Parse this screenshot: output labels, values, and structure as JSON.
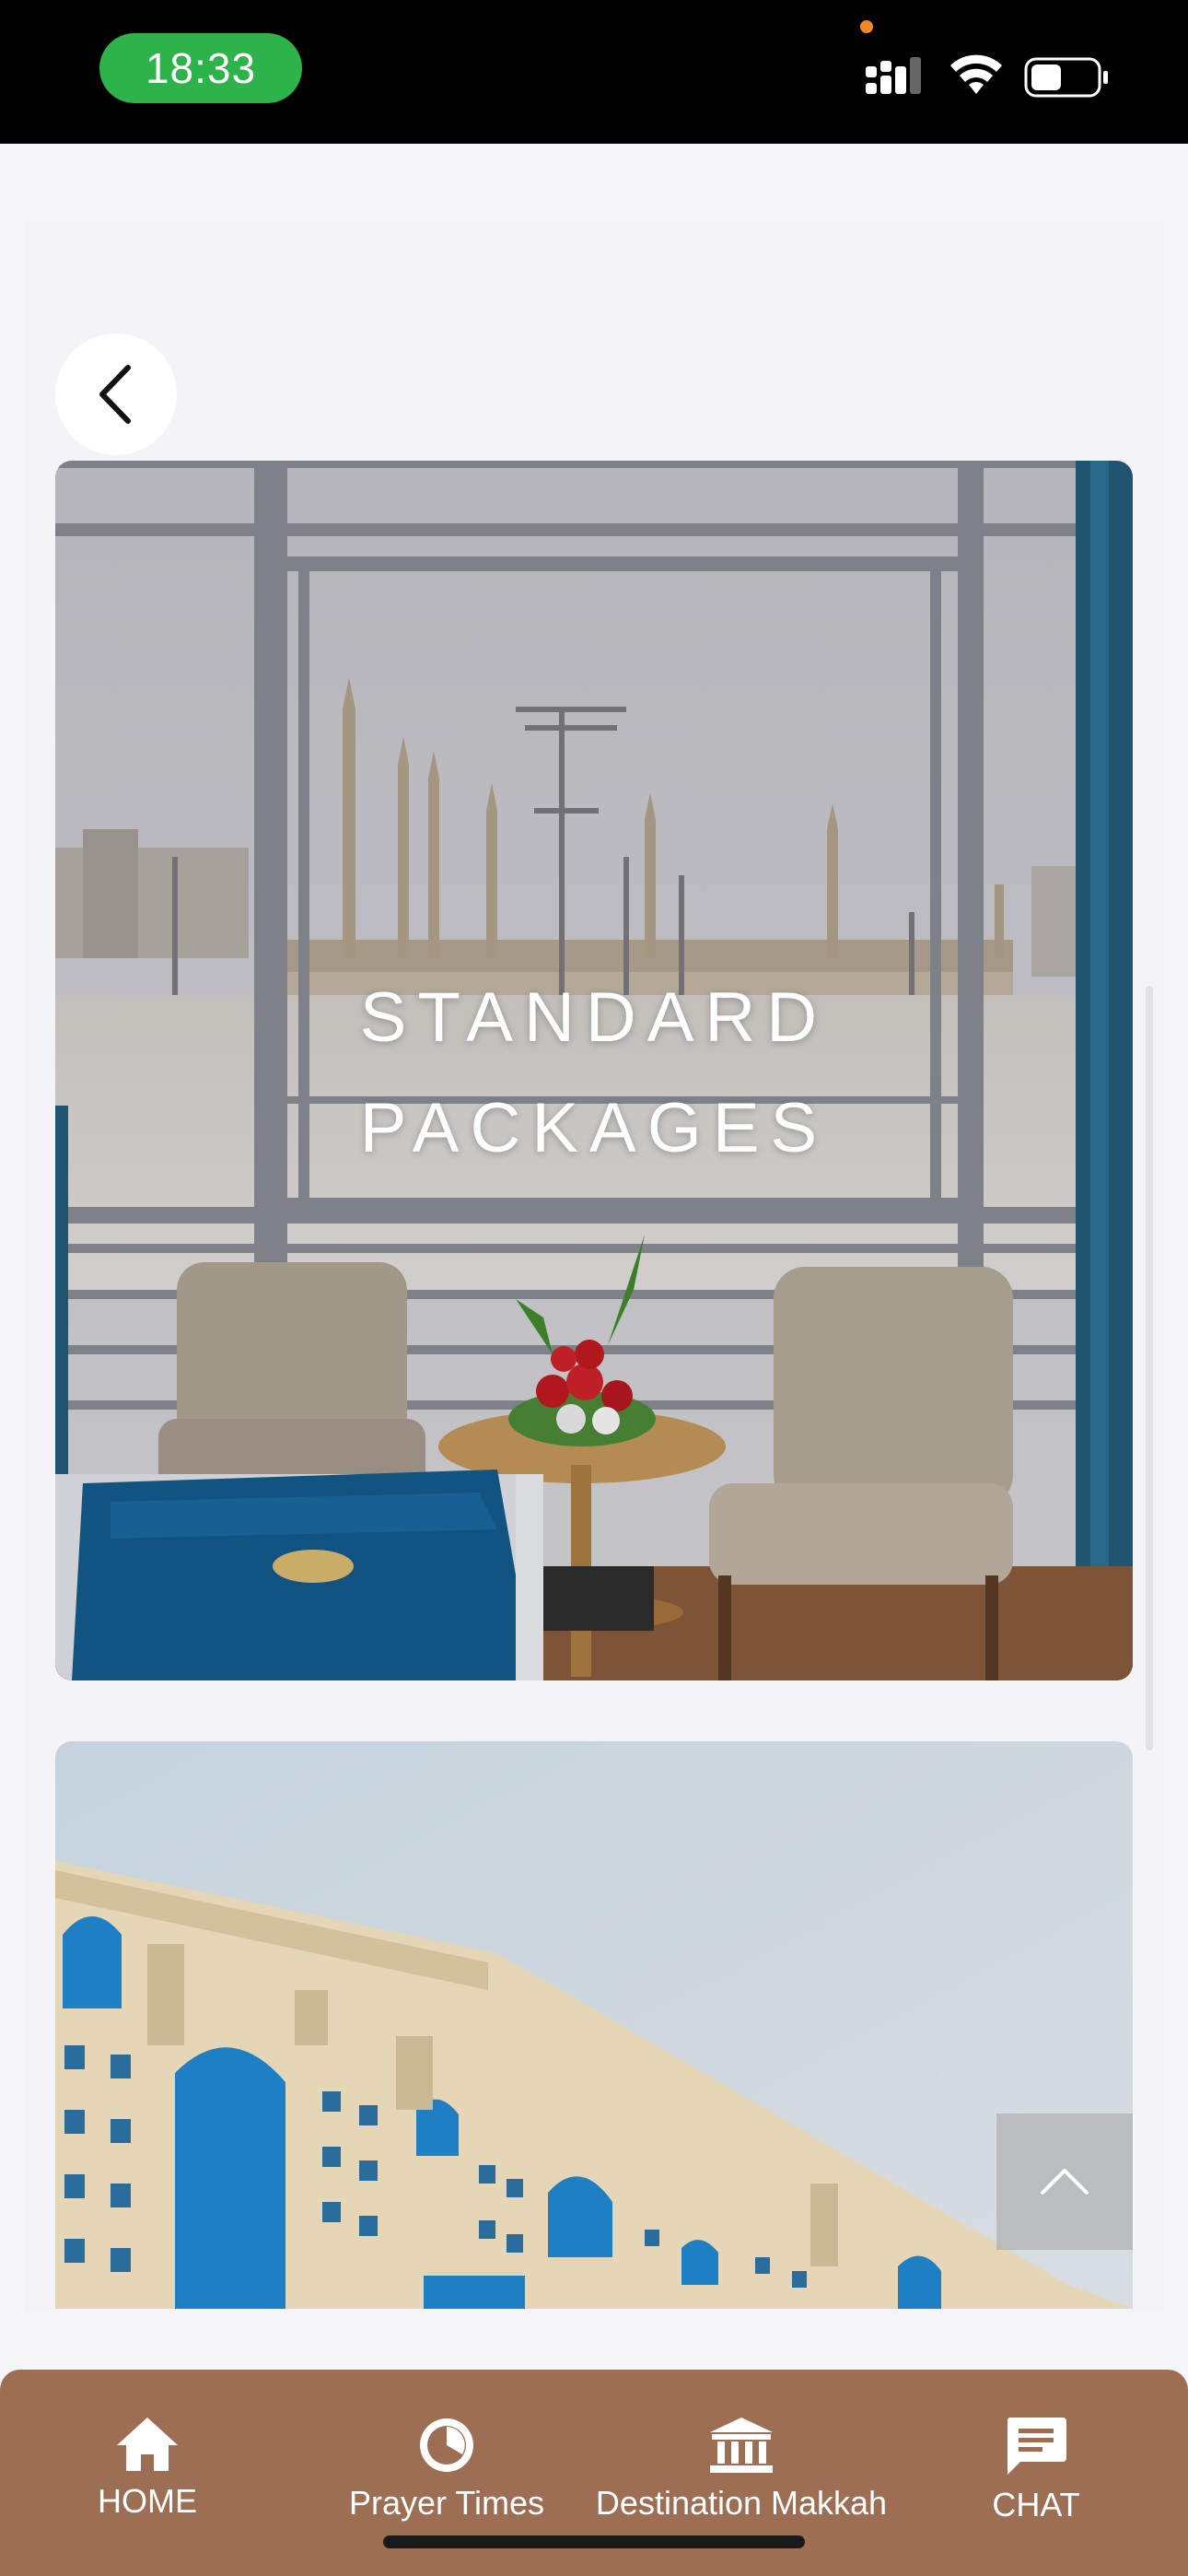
{
  "status_bar": {
    "time": "18:33",
    "icons": [
      "signal-icon",
      "wifi-icon",
      "battery-icon"
    ]
  },
  "header": {
    "back_icon": "chevron-left-icon"
  },
  "cards": [
    {
      "title_line1": "STANDARD",
      "title_line2": "PACKAGES",
      "image": "hotel-room-window-view"
    },
    {
      "title_line1": "",
      "title_line2": "",
      "image": "hotel-building-facade"
    }
  ],
  "scroll_top": {
    "icon": "chevron-up-icon"
  },
  "bottom_nav": {
    "items": [
      {
        "label": "HOME",
        "icon": "home-icon"
      },
      {
        "label": "Prayer Times",
        "icon": "clock-icon"
      },
      {
        "label": "Destination Makkah",
        "icon": "landmark-icon"
      },
      {
        "label": "CHAT",
        "icon": "chat-icon"
      }
    ]
  },
  "colors": {
    "status_bar": "#000000",
    "time_pill": "#2eb24a",
    "nav_background": "#9c6f55",
    "page_background": "#f7f7f9"
  }
}
